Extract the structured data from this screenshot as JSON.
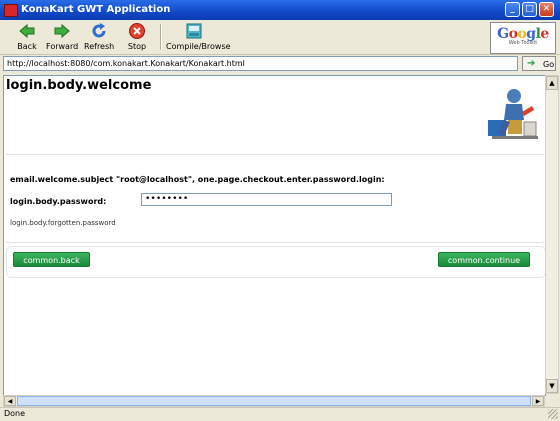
{
  "window": {
    "title": "KonaKart GWT Application"
  },
  "toolbar": {
    "buttons": [
      {
        "label": "Back",
        "icon": "back-arrow-icon"
      },
      {
        "label": "Forward",
        "icon": "forward-arrow-icon"
      },
      {
        "label": "Refresh",
        "icon": "refresh-icon"
      },
      {
        "label": "Stop",
        "icon": "stop-icon"
      },
      {
        "label": "Compile/Browse",
        "icon": "compile-browse-icon"
      }
    ],
    "logo_text": "Google",
    "logo_sub": "Web Toolkit"
  },
  "address_bar": {
    "url": "http://localhost:8080/com.konakart.Konakart/Konakart.html",
    "go_label": "Go"
  },
  "page": {
    "welcome_title": "login.body.welcome",
    "email_line": "email.welcome.subject \"root@localhost\", one.page.checkout.enter.password.login:",
    "password_label": "login.body.password:",
    "password_value": "••••••••",
    "forgotten_link": "login.body.forgotten.password",
    "back_button": "common.back",
    "continue_button": "common.continue"
  },
  "status": {
    "text": "Done"
  },
  "colors": {
    "button_green": "#1a8a3a",
    "title_bar_blue": "#1148c8"
  }
}
